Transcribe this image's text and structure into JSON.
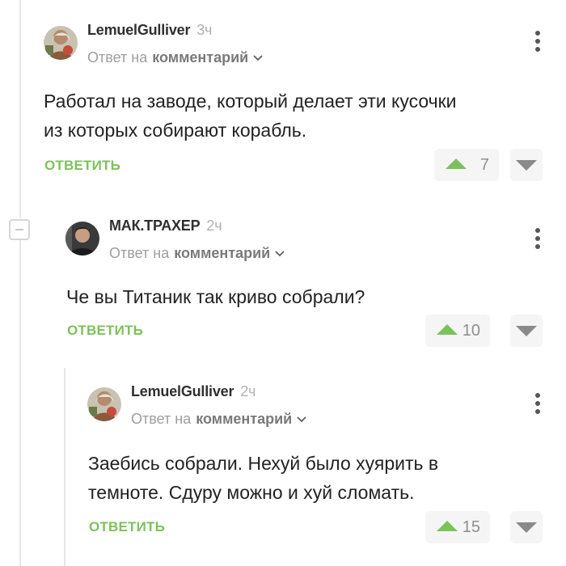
{
  "comments": [
    {
      "author": "LemuelGulliver",
      "time": "3ч",
      "reply_prefix": "Ответ на",
      "reply_target": "комментарий",
      "text_lines": [
        "Работал на заводе, который делает эти кусочки",
        "из которых собирают корабль."
      ],
      "reply_label": "ОТВЕТИТЬ",
      "rating": "7"
    },
    {
      "author": "МАК.ТРАХЕР",
      "time": "2ч",
      "reply_prefix": "Ответ на",
      "reply_target": "комментарий",
      "text_lines": [
        "Че вы Титаник так криво собрали?"
      ],
      "reply_label": "ОТВЕТИТЬ",
      "rating": "10"
    },
    {
      "author": "LemuelGulliver",
      "time": "2ч",
      "reply_prefix": "Ответ на",
      "reply_target": "комментарий",
      "text_lines": [
        "Заебись собрали. Нехуй было хуярить в",
        "темноте. Сдуру можно и хуй сломать."
      ],
      "reply_label": "ОТВЕТИТЬ",
      "rating": "15"
    }
  ],
  "colors": {
    "accent_green": "#7cc25a",
    "thread_line": "#e6e6e6",
    "vote_bg": "#f5f5f5"
  },
  "icons": {
    "kebab": "more-vertical-icon",
    "chevron": "chevron-down-icon",
    "upvote": "arrow-up-icon",
    "downvote": "arrow-down-icon",
    "collapse": "minus-square-icon"
  }
}
